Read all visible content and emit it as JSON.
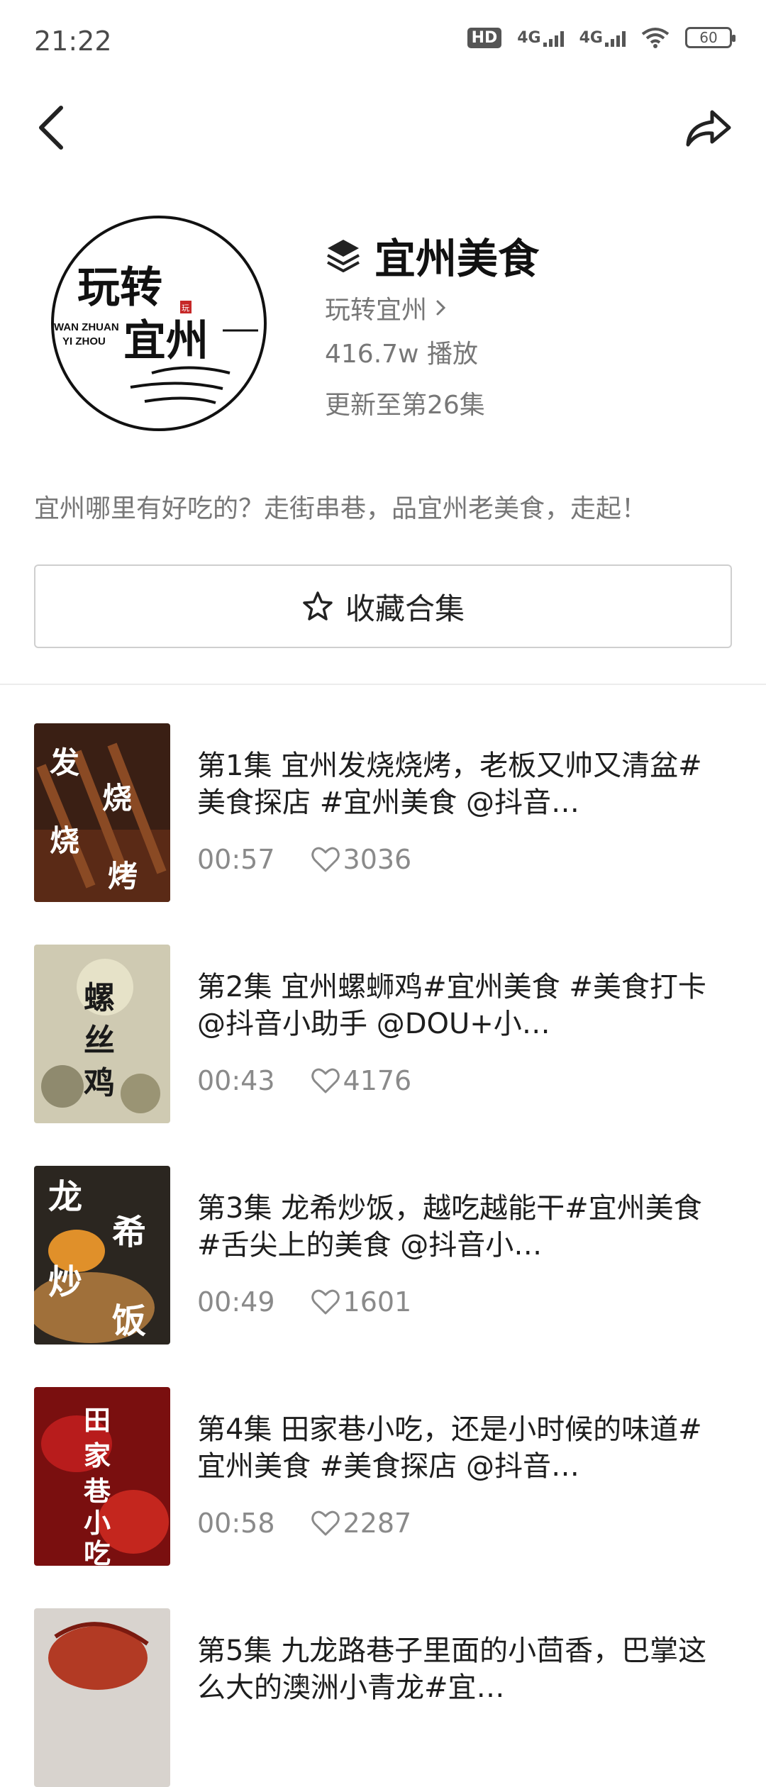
{
  "status_bar": {
    "time": "21:22",
    "hd": "HD",
    "network_1": "4G",
    "network_2": "4G",
    "battery": "60"
  },
  "header": {
    "back_icon": "back-arrow-icon",
    "share_icon": "share-arrow-icon"
  },
  "collection": {
    "title": "宜州美食",
    "title_icon": "layers-icon",
    "cover_line1": "玩转",
    "cover_line2": "宜州",
    "cover_en1": "WAN ZHUAN",
    "cover_en2": "YI ZHOU",
    "cover_stamp": "玩",
    "author": "玩转宜州",
    "plays": "416.7w 播放",
    "updated": "更新至第26集",
    "description": "宜州哪里有好吃的？走街串巷，品宜州老美食，走起！",
    "collect_label": "收藏合集"
  },
  "episodes": [
    {
      "title": "第1集   宜州发烧烧烤，老板又帅又清盆#美食探店 #宜州美食 @抖音…",
      "duration": "00:57",
      "likes": "3036",
      "thumb_text": "发烧烧烤"
    },
    {
      "title": "第2集   宜州螺蛳鸡#宜州美食 #美食打卡 @抖音小助手 @DOU+小…",
      "duration": "00:43",
      "likes": "4176",
      "thumb_text": "螺丝鸡"
    },
    {
      "title": "第3集   龙希炒饭，越吃越能干#宜州美食 #舌尖上的美食 @抖音小…",
      "duration": "00:49",
      "likes": "1601",
      "thumb_text": "龙希炒饭"
    },
    {
      "title": "第4集   田家巷小吃，还是小时候的味道#宜州美食 #美食探店 @抖音…",
      "duration": "00:58",
      "likes": "2287",
      "thumb_text": "田家巷小吃"
    },
    {
      "title": "第5集   九龙路巷子里面的小茴香，巴掌这么大的澳洲小青龙#宜…",
      "duration": "",
      "likes": "",
      "thumb_text": ""
    }
  ]
}
